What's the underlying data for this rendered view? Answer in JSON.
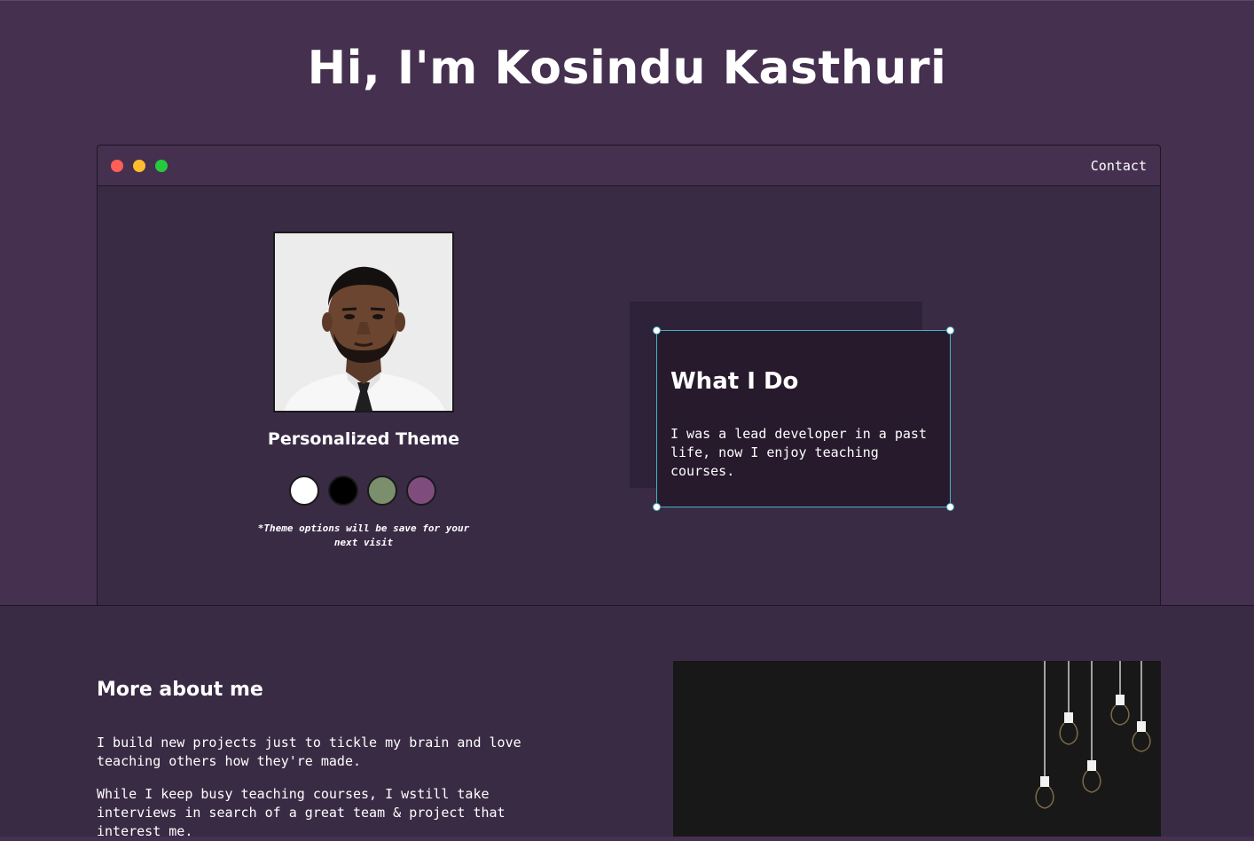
{
  "hero": {
    "title": "Hi, I'm Kosindu Kasthuri"
  },
  "window": {
    "nav": {
      "contact_label": "Contact"
    },
    "profile": {
      "photo_icon": "profile-photo",
      "theme_title": "Personalized Theme",
      "theme_swatches": [
        {
          "name": "light",
          "color": "#ffffff"
        },
        {
          "name": "dark",
          "color": "#000000"
        },
        {
          "name": "green",
          "color": "#7b8f6d"
        },
        {
          "name": "purple",
          "color": "#7e4d7e"
        }
      ],
      "theme_note": "*Theme options will be save for your next visit"
    },
    "card": {
      "title": "What I Do",
      "text": "I was a lead developer in a past life, now I enjoy teaching courses."
    }
  },
  "about": {
    "title": "More about me",
    "paragraph_1": "I build new projects just to tickle my brain and love teaching others how they're made.",
    "paragraph_2": "While I keep busy teaching courses, I wstill take interviews in search of a great team & project that interest me.",
    "image_icon": "light-bulbs-image"
  },
  "colors": {
    "page_bg": "#45304f",
    "window_bg": "#3a2b45",
    "card_bg": "#261a2c",
    "selection_border": "#4ab0c4",
    "image_bg": "#181818"
  }
}
